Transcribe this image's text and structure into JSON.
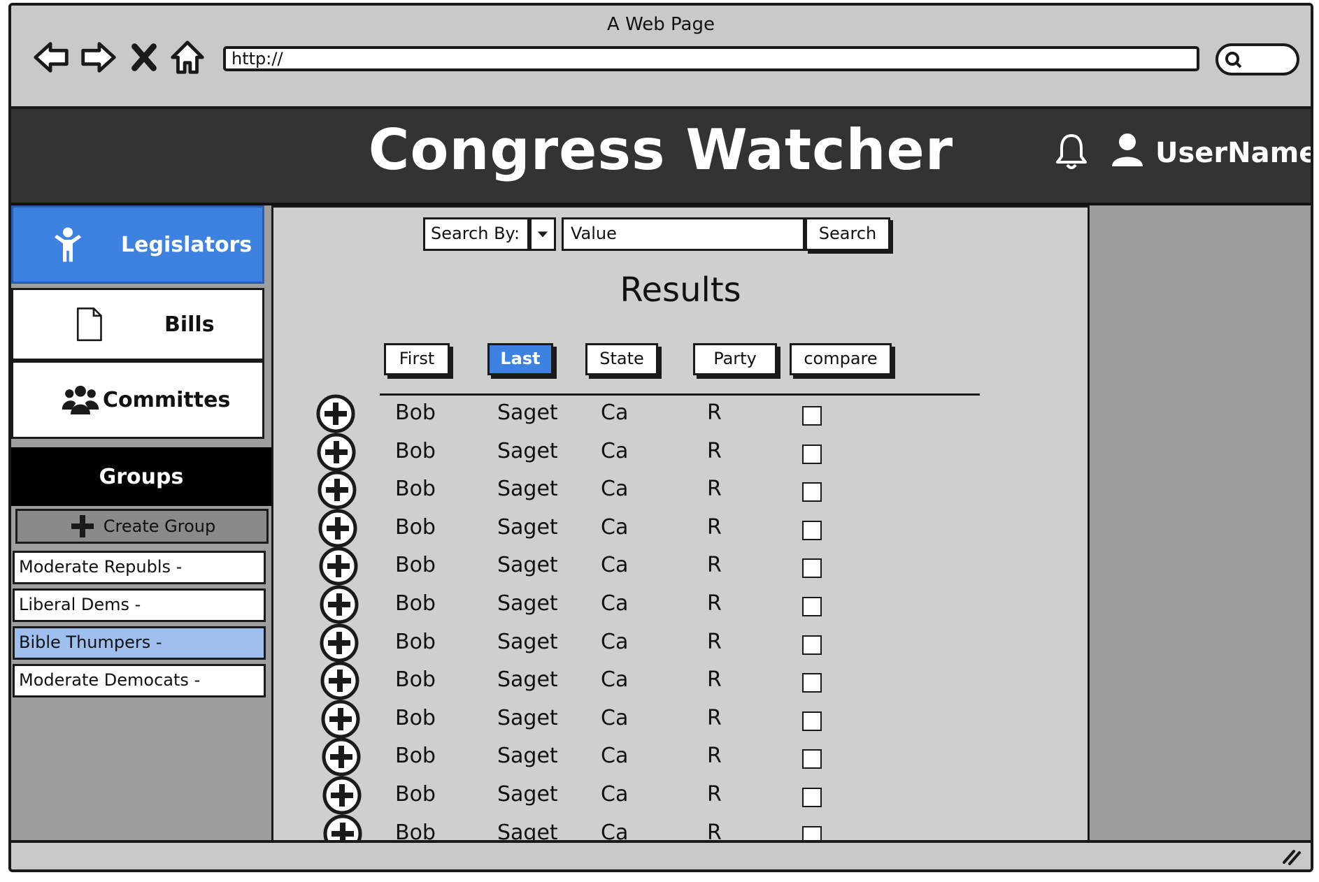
{
  "browser": {
    "window_title": "A Web Page",
    "url": "http://"
  },
  "app": {
    "title": "Congress Watcher",
    "username": "UserName"
  },
  "sidebar": {
    "nav": [
      {
        "label": "Legislators",
        "icon": "person-icon",
        "active": true
      },
      {
        "label": "Bills",
        "icon": "document-icon",
        "active": false
      },
      {
        "label": "Committes",
        "icon": "group-icon",
        "active": false
      }
    ],
    "groups_heading": "Groups",
    "create_group_label": "Create Group",
    "groups": [
      {
        "label": "Moderate Republs  -",
        "selected": false
      },
      {
        "label": "Liberal Dems -",
        "selected": false
      },
      {
        "label": "Bible Thumpers -",
        "selected": true
      },
      {
        "label": "Moderate Democats -",
        "selected": false
      }
    ]
  },
  "search": {
    "search_by_label": "Search By:",
    "value_placeholder": "Value",
    "button_label": "Search"
  },
  "results": {
    "title": "Results",
    "columns": [
      "First",
      "Last",
      "State",
      "Party",
      "compare"
    ],
    "sorted_column": "Last",
    "rows": [
      {
        "first": "Bob",
        "last": "Saget",
        "state": "Ca",
        "party": "R",
        "compare": false
      },
      {
        "first": "Bob",
        "last": "Saget",
        "state": "Ca",
        "party": "R",
        "compare": false
      },
      {
        "first": "Bob",
        "last": "Saget",
        "state": "Ca",
        "party": "R",
        "compare": false
      },
      {
        "first": "Bob",
        "last": "Saget",
        "state": "Ca",
        "party": "R",
        "compare": false
      },
      {
        "first": "Bob",
        "last": "Saget",
        "state": "Ca",
        "party": "R",
        "compare": false
      },
      {
        "first": "Bob",
        "last": "Saget",
        "state": "Ca",
        "party": "R",
        "compare": false
      },
      {
        "first": "Bob",
        "last": "Saget",
        "state": "Ca",
        "party": "R",
        "compare": false
      },
      {
        "first": "Bob",
        "last": "Saget",
        "state": "Ca",
        "party": "R",
        "compare": false
      },
      {
        "first": "Bob",
        "last": "Saget",
        "state": "Ca",
        "party": "R",
        "compare": false
      },
      {
        "first": "Bob",
        "last": "Saget",
        "state": "Ca",
        "party": "R",
        "compare": false
      },
      {
        "first": "Bob",
        "last": "Saget",
        "state": "Ca",
        "party": "R",
        "compare": false
      },
      {
        "first": "Bob",
        "last": "Saget",
        "state": "Ca",
        "party": "R",
        "compare": false
      }
    ]
  },
  "colors": {
    "accent": "#3d82e0",
    "header_bg": "#333333",
    "selected_group": "#9fc0ef"
  }
}
